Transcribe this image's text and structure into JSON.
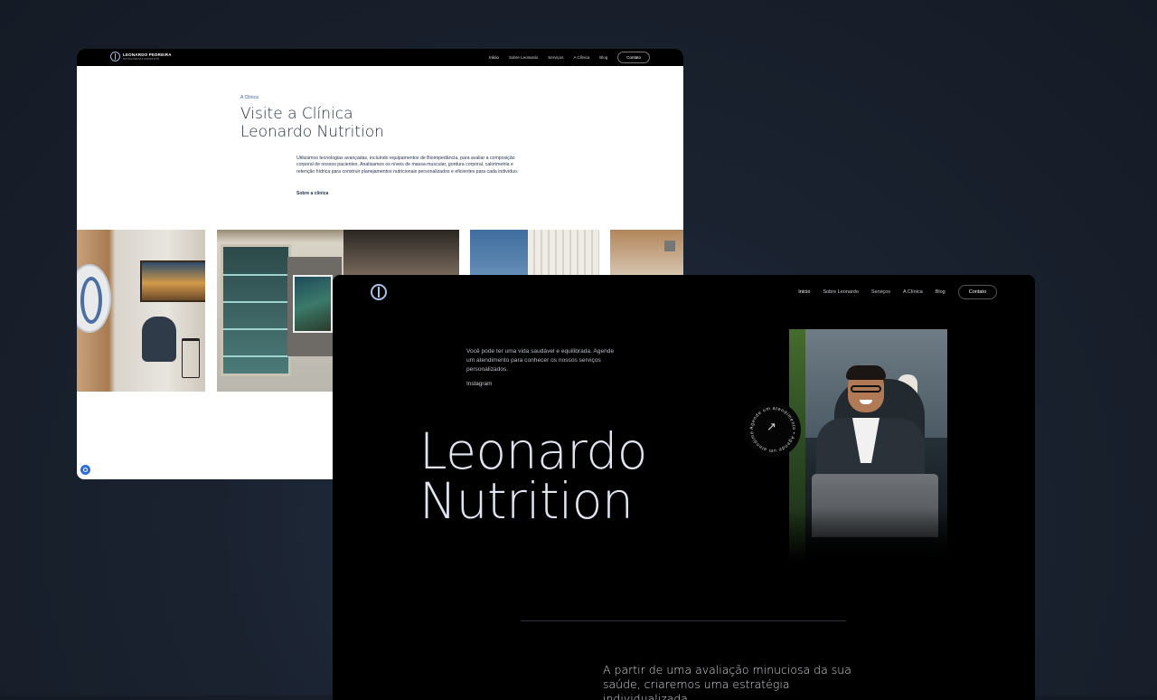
{
  "back_window": {
    "nav": {
      "brand": "LEONARDO PEDREIRA",
      "brand_sub": "NUTRICIONISTA ESPORTIVO",
      "links": [
        "Início",
        "Sobre Leonardo",
        "Serviços",
        "A Clínica",
        "Blog"
      ],
      "contact_label": "Contato"
    },
    "eyebrow": "A Clínica",
    "title_line1": "Visite a Clínica",
    "title_line2": "Leonardo Nutrition",
    "paragraph": "Utilizamos tecnologias avançadas, incluindo equipamentos de Bioimpedância, para avaliar a composição corporal de nossos pacientes. Analisamos os níveis de massa muscular, gordura corporal, calorimetria e retenção hídrica para construir planejamentos nutricionais personalizados e eficientes para cada indivíduo.",
    "link_label": "Sobre a clínica"
  },
  "front_window": {
    "nav": {
      "links": [
        "Início",
        "Sobre Leonardo",
        "Serviços",
        "A Clínica",
        "Blog"
      ],
      "contact_label": "Contato"
    },
    "intro": "Você pode ter uma vida saudável e equilibrada. Agende um atendimento para conhecer os nossos serviços personalizados.",
    "instagram_label": "Instagram",
    "hero_line1": "Leonardo",
    "hero_line2": "Nutrition",
    "badge_text": "Agende um atendimento • Agende um atendimento •",
    "badge_arrow": "↗",
    "lower_paragraph": "A partir de uma avaliação minuciosa da sua saúde, criaremos uma estratégia individualizada"
  },
  "colors": {
    "page_bg": "#1a2230",
    "accent_blue": "#3b5f9e",
    "hero_text": "#dfe6f2"
  }
}
